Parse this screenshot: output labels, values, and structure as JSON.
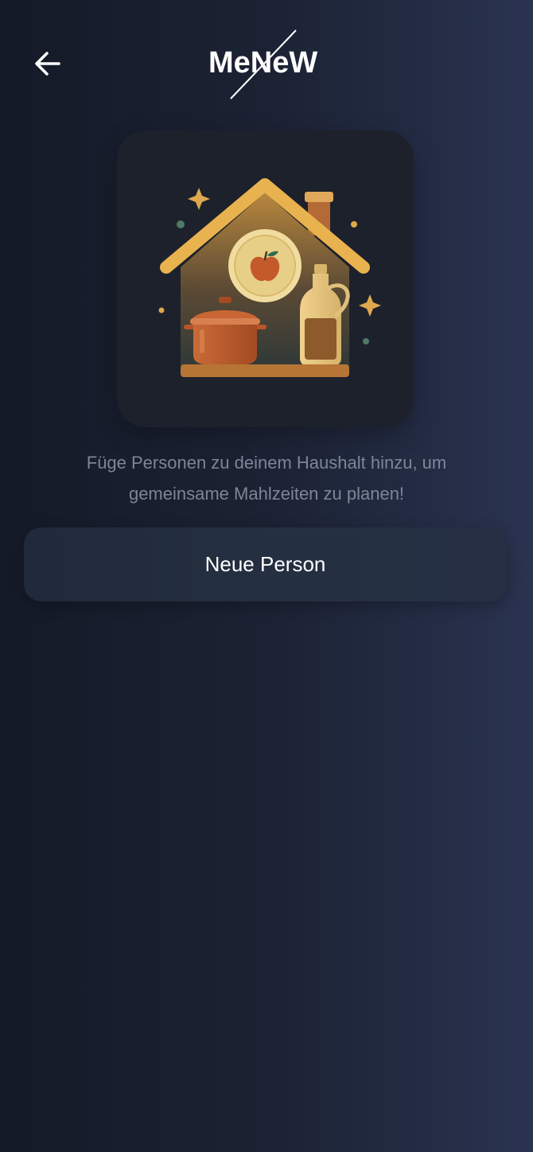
{
  "header": {
    "back_icon": "arrow-left-icon",
    "logo_text": "MeNeW"
  },
  "illustration": {
    "icon": "house-kitchen-illustration"
  },
  "main": {
    "info_line_1": "Füge Personen zu deinem Haushalt hinzu, um",
    "info_line_2": "gemeinsame Mahlzeiten zu planen!",
    "new_person_label": "Neue Person"
  },
  "colors": {
    "background_start": "#141a27",
    "background_end": "#2a3350",
    "card": "#1c212b",
    "text_muted": "#7d8596",
    "roof": "#e3b457",
    "pot": "#c0602e",
    "bottle": "#e0c07a"
  }
}
